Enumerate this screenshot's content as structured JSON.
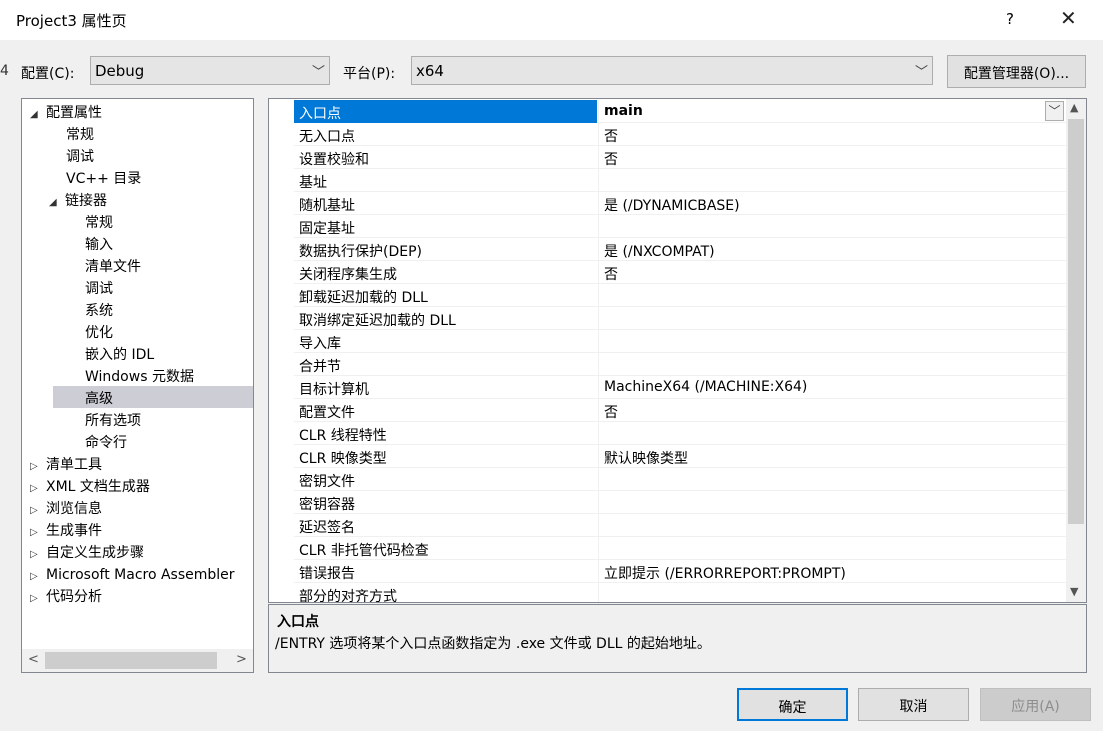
{
  "window": {
    "title": "Project3 属性页",
    "help": "?",
    "close": "✕"
  },
  "left_edge_char": "4",
  "config": {
    "label": "配置(C):",
    "value": "Debug"
  },
  "platform": {
    "label": "平台(P):",
    "value": "x64"
  },
  "config_manager_label": "配置管理器(O)...",
  "tree": [
    {
      "label": "配置属性",
      "toggle": "◢",
      "expanded": true
    },
    {
      "label": "常规"
    },
    {
      "label": "调试"
    },
    {
      "label": "VC++ 目录"
    },
    {
      "label": "链接器",
      "toggle": "◢",
      "expanded": true
    },
    {
      "label": "常规"
    },
    {
      "label": "输入"
    },
    {
      "label": "清单文件"
    },
    {
      "label": "调试"
    },
    {
      "label": "系统"
    },
    {
      "label": "优化"
    },
    {
      "label": "嵌入的 IDL"
    },
    {
      "label": "Windows 元数据"
    },
    {
      "label": "高级",
      "selected": true
    },
    {
      "label": "所有选项"
    },
    {
      "label": "命令行"
    },
    {
      "label": "清单工具",
      "toggle": "▷"
    },
    {
      "label": "XML 文档生成器",
      "toggle": "▷"
    },
    {
      "label": "浏览信息",
      "toggle": "▷"
    },
    {
      "label": "生成事件",
      "toggle": "▷"
    },
    {
      "label": "自定义生成步骤",
      "toggle": "▷"
    },
    {
      "label": "Microsoft Macro Assembler",
      "toggle": "▷"
    },
    {
      "label": "代码分析",
      "toggle": "▷"
    }
  ],
  "properties": [
    {
      "name": "入口点",
      "value": "main",
      "selected": true
    },
    {
      "name": "无入口点",
      "value": "否"
    },
    {
      "name": "设置校验和",
      "value": "否"
    },
    {
      "name": "基址",
      "value": ""
    },
    {
      "name": "随机基址",
      "value": "是 (/DYNAMICBASE)"
    },
    {
      "name": "固定基址",
      "value": ""
    },
    {
      "name": "数据执行保护(DEP)",
      "value": "是 (/NXCOMPAT)"
    },
    {
      "name": "关闭程序集生成",
      "value": "否"
    },
    {
      "name": "卸载延迟加载的 DLL",
      "value": ""
    },
    {
      "name": "取消绑定延迟加载的 DLL",
      "value": ""
    },
    {
      "name": "导入库",
      "value": ""
    },
    {
      "name": "合并节",
      "value": ""
    },
    {
      "name": "目标计算机",
      "value": "MachineX64 (/MACHINE:X64)"
    },
    {
      "name": "配置文件",
      "value": "否"
    },
    {
      "name": "CLR 线程特性",
      "value": ""
    },
    {
      "name": "CLR 映像类型",
      "value": "默认映像类型"
    },
    {
      "name": "密钥文件",
      "value": ""
    },
    {
      "name": "密钥容器",
      "value": ""
    },
    {
      "name": "延迟签名",
      "value": ""
    },
    {
      "name": "CLR 非托管代码检查",
      "value": ""
    },
    {
      "name": "错误报告",
      "value": "立即提示 (/ERRORREPORT:PROMPT)"
    },
    {
      "name": "部分的对齐方式",
      "value": ""
    }
  ],
  "description": {
    "title": "入口点",
    "text": "/ENTRY 选项将某个入口点函数指定为 .exe 文件或 DLL 的起始地址。"
  },
  "buttons": {
    "ok": "确定",
    "cancel": "取消",
    "apply": "应用(A)"
  },
  "colors": {
    "selection": "#0078d7",
    "tree_selection": "#cdcdd6",
    "ok_border": "#0078d7"
  }
}
